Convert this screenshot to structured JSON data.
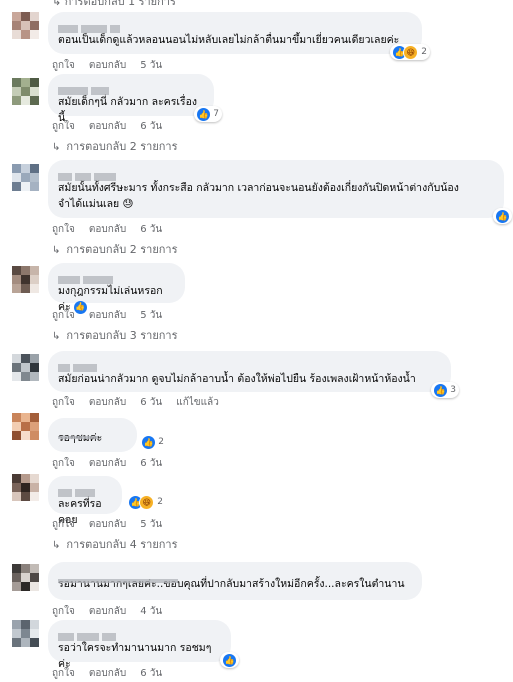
{
  "labels": {
    "like": "ถูกใจ",
    "reply": "ตอบกลับ",
    "edited": "แก้ไขแล้ว"
  },
  "top_link": "การตอบกลับ 1 รายการ",
  "comments": [
    {
      "text": "ตอนเป็นเด็กดูแล้วหลอนนอนไม่หลับเลยไม่กล้าตื่นมาขึ้มาเยี่ยวคนเดียวเลยค่ะ",
      "time": "5 วัน",
      "reactions": "2",
      "replies": ""
    },
    {
      "text": "สมัยเด็กๆนี่ กลัวมาก ละครเรื่องนี้",
      "time": "6 วัน",
      "reactions": "7",
      "replies": "การตอบกลับ 2 รายการ"
    },
    {
      "text": "สมัยนั้นทั้งศรีษะมาร ทั้งกระสือ กลัวมาก เวลาก่อนจะนอนยังต้องเกี่ยงกันปิดหน้าต่างกับน้อง\nจำได้แม่นเลย 😓",
      "time": "6 วัน",
      "reactions": "",
      "replies": "การตอบกลับ 2 รายการ"
    },
    {
      "text": "มงกุฎกรรมไม่เล่นหรอกค่ะ",
      "time": "5 วัน",
      "reactions": "",
      "replies": "การตอบกลับ 3 รายการ"
    },
    {
      "text": "สมัยก่อนน่ากลัวมาก ดูจบไม่กล้าอาบน้ำ ต้องให้พ่อไปยืน ร้องเพลงเฝ้าหน้าห้องน้ำ",
      "time": "6 วัน",
      "reactions": "3",
      "replies": ""
    },
    {
      "text": "รอๆชมค่ะ",
      "time": "6 วัน",
      "reactions": "2",
      "replies": ""
    },
    {
      "text": "ละครที่รอคอย",
      "time": "5 วัน",
      "reactions": "2",
      "replies": "การตอบกลับ 4 รายการ"
    },
    {
      "text": "รอมานานมากๆเลยค่ะ..ขอบคุณที่ปากลับมาสร้างใหม่อีกครั้ง...ละครในตำนาน",
      "time": "4 วัน",
      "reactions": "",
      "replies": ""
    },
    {
      "text": "รอว่าใครจะทำมานานมาก รอชมๆค่ะ",
      "time": "6 วัน",
      "reactions": "",
      "replies": ""
    }
  ]
}
